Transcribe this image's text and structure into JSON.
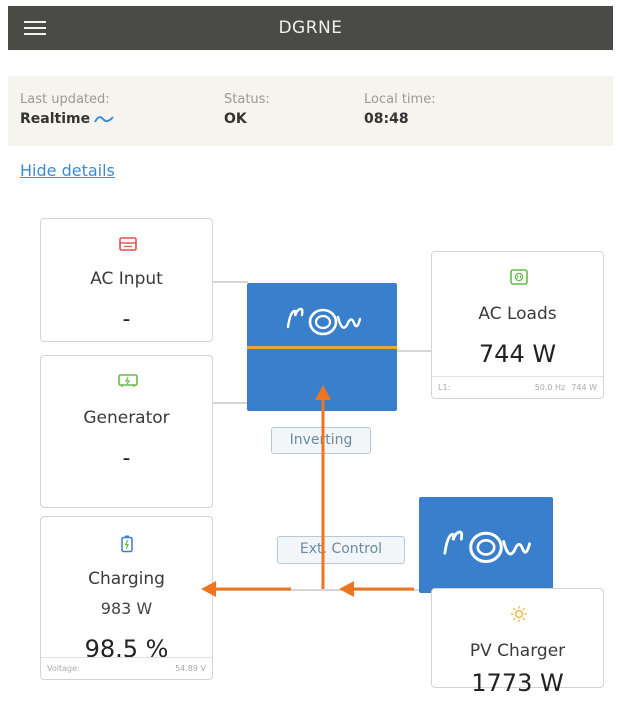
{
  "header": {
    "title": "DGRNE",
    "menu_icon": "hamburger-icon"
  },
  "info": {
    "last_updated_label": "Last updated:",
    "last_updated_value": "Realtime",
    "status_label": "Status:",
    "status_value": "OK",
    "local_time_label": "Local time:",
    "local_time_value": "08:48"
  },
  "hide_details": "Hide details",
  "ac_input": {
    "title": "AC Input",
    "value": "-",
    "icon": "ac-input-icon"
  },
  "generator": {
    "title": "Generator",
    "value": "-",
    "icon": "generator-icon"
  },
  "battery": {
    "title": "Charging",
    "power": "983 W",
    "soc": "98.5 %",
    "voltage_label": "Voltage:",
    "voltage_value": "54.89 V",
    "icon": "battery-icon"
  },
  "ac_loads": {
    "title": "AC Loads",
    "value": "744 W",
    "phase_label": "L1:",
    "frequency": "50.0 Hz",
    "phase_power": "744 W",
    "icon": "ac-loads-icon"
  },
  "pv_charger": {
    "title": "PV Charger",
    "value": "1773 W",
    "icon": "sun-icon"
  },
  "inverter": {
    "state": "Inverting",
    "logo_icon": "victron-logo-icon"
  },
  "charger": {
    "state": "Ext. Control",
    "logo_icon": "victron-logo-icon"
  },
  "colors": {
    "header_bg": "#4a4a47",
    "accent_blue": "#3a7fcb",
    "link_blue": "#3d8bd4",
    "arrow_orange": "#ee7623",
    "ac_line_orange": "#e6a63a",
    "ac_icon_red": "#e0524a",
    "green_icon": "#69b84a",
    "sun_yellow": "#e7b93a"
  }
}
